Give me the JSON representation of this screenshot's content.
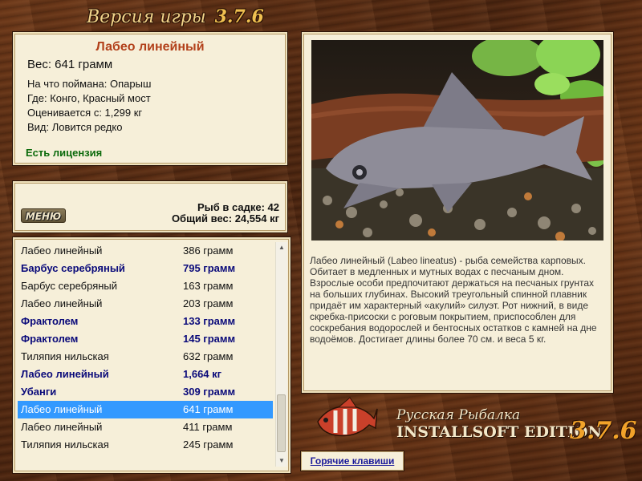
{
  "header": {
    "title": "Версия игры",
    "version": "3.7.6"
  },
  "catch_info": {
    "fish_name": "Лабео линейный",
    "weight": "Вес: 641 грамм",
    "bait": "На что поймана: Опарыш",
    "place": "Где: Конго, Красный мост",
    "rated_from": "Оценивается с: 1,299 кг",
    "kind": "Вид: Ловится редко",
    "license": "Есть лицензия"
  },
  "keepnet": {
    "menu_label": "МЕНЮ",
    "count": "Рыб в садке: 42",
    "total": "Общий вес: 24,554 кг"
  },
  "fish_list": [
    {
      "name": "Лабео линейный",
      "weight": "386 грамм",
      "big": false,
      "selected": false
    },
    {
      "name": "Барбус серебряный",
      "weight": "795 грамм",
      "big": true,
      "selected": false
    },
    {
      "name": "Барбус серебряный",
      "weight": "163 грамм",
      "big": false,
      "selected": false
    },
    {
      "name": "Лабео линейный",
      "weight": "203 грамм",
      "big": false,
      "selected": false
    },
    {
      "name": "Фрактолем",
      "weight": "133 грамм",
      "big": true,
      "selected": false
    },
    {
      "name": "Фрактолем",
      "weight": "145 грамм",
      "big": true,
      "selected": false
    },
    {
      "name": "Тиляпия нильская",
      "weight": "632 грамм",
      "big": false,
      "selected": false
    },
    {
      "name": "Лабео линейный",
      "weight": "1,664 кг",
      "big": true,
      "selected": false
    },
    {
      "name": "Убанги",
      "weight": "309 грамм",
      "big": true,
      "selected": false
    },
    {
      "name": "Лабео линейный",
      "weight": "641 грамм",
      "big": false,
      "selected": true
    },
    {
      "name": "Лабео линейный",
      "weight": "411 грамм",
      "big": false,
      "selected": false
    },
    {
      "name": "Тиляпия нильская",
      "weight": "245 грамм",
      "big": false,
      "selected": false
    }
  ],
  "description": "Лабео линейный (Labeo lineatus) - рыба семейства карповых. Обитает в медленных и мутных водах с песчаным дном. Взрослые особи предпочитают держаться на песчаных грунтах на больших глубинах. Высокий треугольный спинной плавник придаёт им характерный «акулий» силуэт. Рот нижний, в виде скребка-присоски с роговым покрытием, приспособлен для соскребания водорослей и бентосных остатков с камней на дне водоёмов. Достигает длины более 70 см. и веса 5 кг.",
  "branding": {
    "line1": "Русская Рыбалка",
    "line2": "INSTALLSOFT EDITION",
    "version": "3.7.6"
  },
  "footer": {
    "hotkeys_label": "Горячие клавиши"
  },
  "icons": {
    "up": "arrow-up-icon",
    "down": "arrow-down-icon",
    "logo": "fish-logo-icon"
  },
  "colors": {
    "fish_name": "#b2401a",
    "license": "#0b6a0b",
    "big_fish": "#0a0a7a",
    "selection": "#3399ff"
  }
}
